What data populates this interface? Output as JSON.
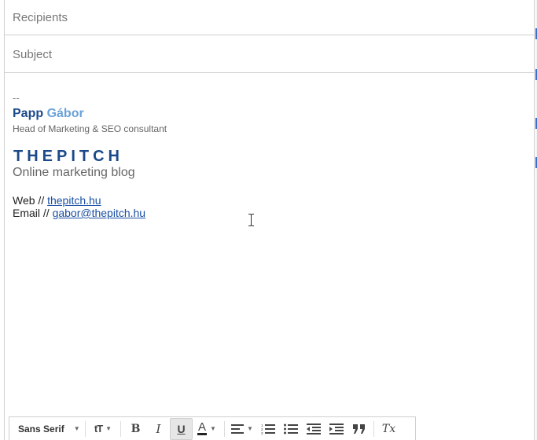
{
  "compose": {
    "recipients_placeholder": "Recipients",
    "subject_placeholder": "Subject"
  },
  "signature": {
    "dash": "--",
    "first_name": "Papp",
    "last_name": "Gábor",
    "role": "Head of Marketing & SEO consultant",
    "logo": "THEPITCH",
    "tagline": "Online marketing blog",
    "web_label": "Web // ",
    "web_link": "thepitch.hu",
    "email_label": "Email // ",
    "email_link": "gabor@thepitch.hu"
  },
  "toolbar": {
    "font": "Sans Serif",
    "size_icon": "tT",
    "bold": "B",
    "italic": "I",
    "underline": "U",
    "text_color": "A",
    "remove_format": "Tx"
  },
  "colors": {
    "name_dark": "#1b4a8a",
    "name_light": "#6aa1d8",
    "link": "#1a4fa3",
    "accent_strip": "#3a6fd0"
  }
}
